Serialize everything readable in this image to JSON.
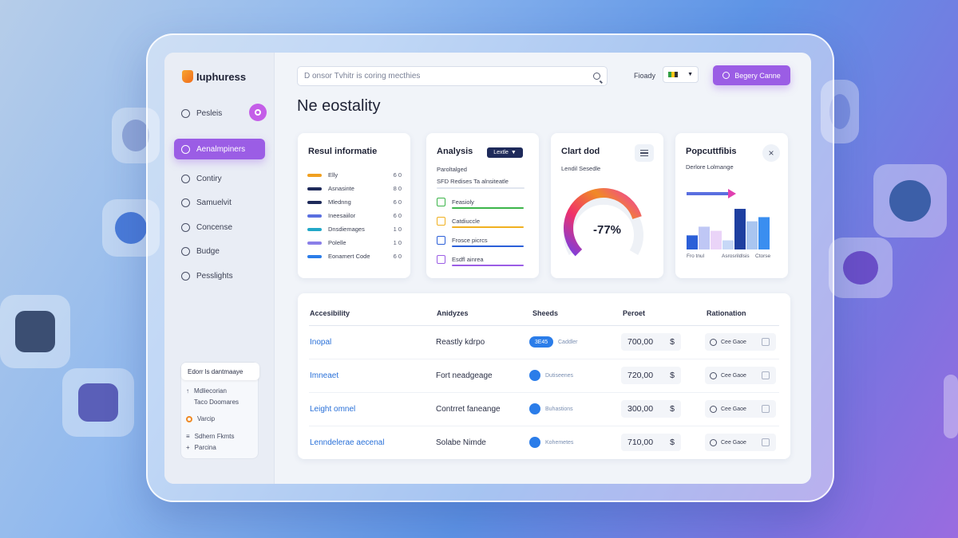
{
  "brand": {
    "name": "Iuphuress"
  },
  "sidebar": {
    "items": [
      {
        "label": "Pesleis",
        "icon": "globe-icon"
      },
      {
        "label": "Aenalmpiners",
        "icon": "chart-icon"
      },
      {
        "label": "Contiry",
        "icon": "folder-icon"
      },
      {
        "label": "Samuelvit",
        "icon": "list-icon"
      },
      {
        "label": "Concense",
        "icon": "settings-icon"
      },
      {
        "label": "Budge",
        "icon": "globe-icon"
      },
      {
        "label": "Pesslights",
        "icon": "bulb-icon"
      }
    ],
    "panel": {
      "button": "Edorr ls dantmaaye",
      "lines": [
        "Mdliecorian",
        "Taco Doomares",
        "Varcip",
        "Sdhern Fkmts",
        "Parcina"
      ]
    }
  },
  "header": {
    "search_placeholder": "D onsor Tvhitr is coring mecthies",
    "filter_label": "Fioady",
    "filter_value": "",
    "cta_label": "Begery Canne"
  },
  "page": {
    "title": "Ne eostality"
  },
  "cards": {
    "result": {
      "title": "Resul informatie",
      "rows": [
        {
          "label": "Elly",
          "value": "6 0",
          "color": "#f0a020"
        },
        {
          "label": "Asnasinte",
          "value": "8 0",
          "color": "#1e2a5a"
        },
        {
          "label": "Mlednng",
          "value": "6 0",
          "color": "#1e2a5a"
        },
        {
          "label": "Ineesaiilor",
          "value": "6 0",
          "color": "#5a6fe0"
        },
        {
          "label": "Dnsdiemages",
          "value": "1 0",
          "color": "#22a8c8"
        },
        {
          "label": "Polelle",
          "value": "1 0",
          "color": "#8a7fe8"
        },
        {
          "label": "Eonamert Code",
          "value": "6 0",
          "color": "#2b7de9"
        }
      ]
    },
    "analytics": {
      "title": "Analysis",
      "tag": "Lextle",
      "subtitle1": "Paroltalged",
      "subtitle2": "SFD Redises   Ta alnsiteatle",
      "rows": [
        {
          "label": "Feasioly",
          "color": "#3cb54a"
        },
        {
          "label": "Catdiuccle",
          "color": "#f0b020"
        },
        {
          "label": "Frosce picrcs",
          "color": "#2b5fd8"
        },
        {
          "label": "Esdfl ainrea",
          "color": "#9b5de5"
        }
      ]
    },
    "gauge": {
      "title": "Clart dod",
      "subtitle": "Lendil Sesedle",
      "value": "-77%",
      "fraction": 0.77
    },
    "pop": {
      "title": "Popcuttfibis",
      "subtitle": "Derlore Lolmange",
      "bars": [
        {
          "h": 0.34,
          "color": "#2b5fd8"
        },
        {
          "h": 0.55,
          "color": "#bfc7f5"
        },
        {
          "h": 0.45,
          "color": "#ead4f8"
        },
        {
          "h": 0.22,
          "color": "#c7d8f7"
        },
        {
          "h": 0.98,
          "color": "#1e3fa0"
        },
        {
          "h": 0.68,
          "color": "#a9c5f0"
        },
        {
          "h": 0.78,
          "color": "#3a8ef0"
        }
      ],
      "labels": [
        "Fro tnul",
        "Asrosrildlsis",
        "Ctorse"
      ]
    }
  },
  "table": {
    "headers": [
      "Accesibility",
      "Anidyzes",
      "Sheeds",
      "Peroet",
      "Rationation"
    ],
    "rows": [
      {
        "name": "Inopal",
        "analysis": "Reastly kdrpo",
        "badge": "3E45",
        "badge_text": "Caddler",
        "price": "700,00",
        "currency": "$",
        "action": "Cee Gaoe"
      },
      {
        "name": "Imneaet",
        "analysis": "Fort neadgeage",
        "badge": "",
        "badge_text": "Dutiseenes",
        "price": "720,00",
        "currency": "$",
        "action": "Cee Gaoe"
      },
      {
        "name": "Leight omnel",
        "analysis": "Contrret faneange",
        "badge": "",
        "badge_text": "Buhastions",
        "price": "300,00",
        "currency": "$",
        "action": "Cee Gaoe"
      },
      {
        "name": "Lenndelerae aecenal",
        "analysis": "Solabe Nimde",
        "badge": "",
        "badge_text": "Kohemetes",
        "price": "710,00",
        "currency": "$",
        "action": "Cee Gaoe"
      }
    ]
  }
}
